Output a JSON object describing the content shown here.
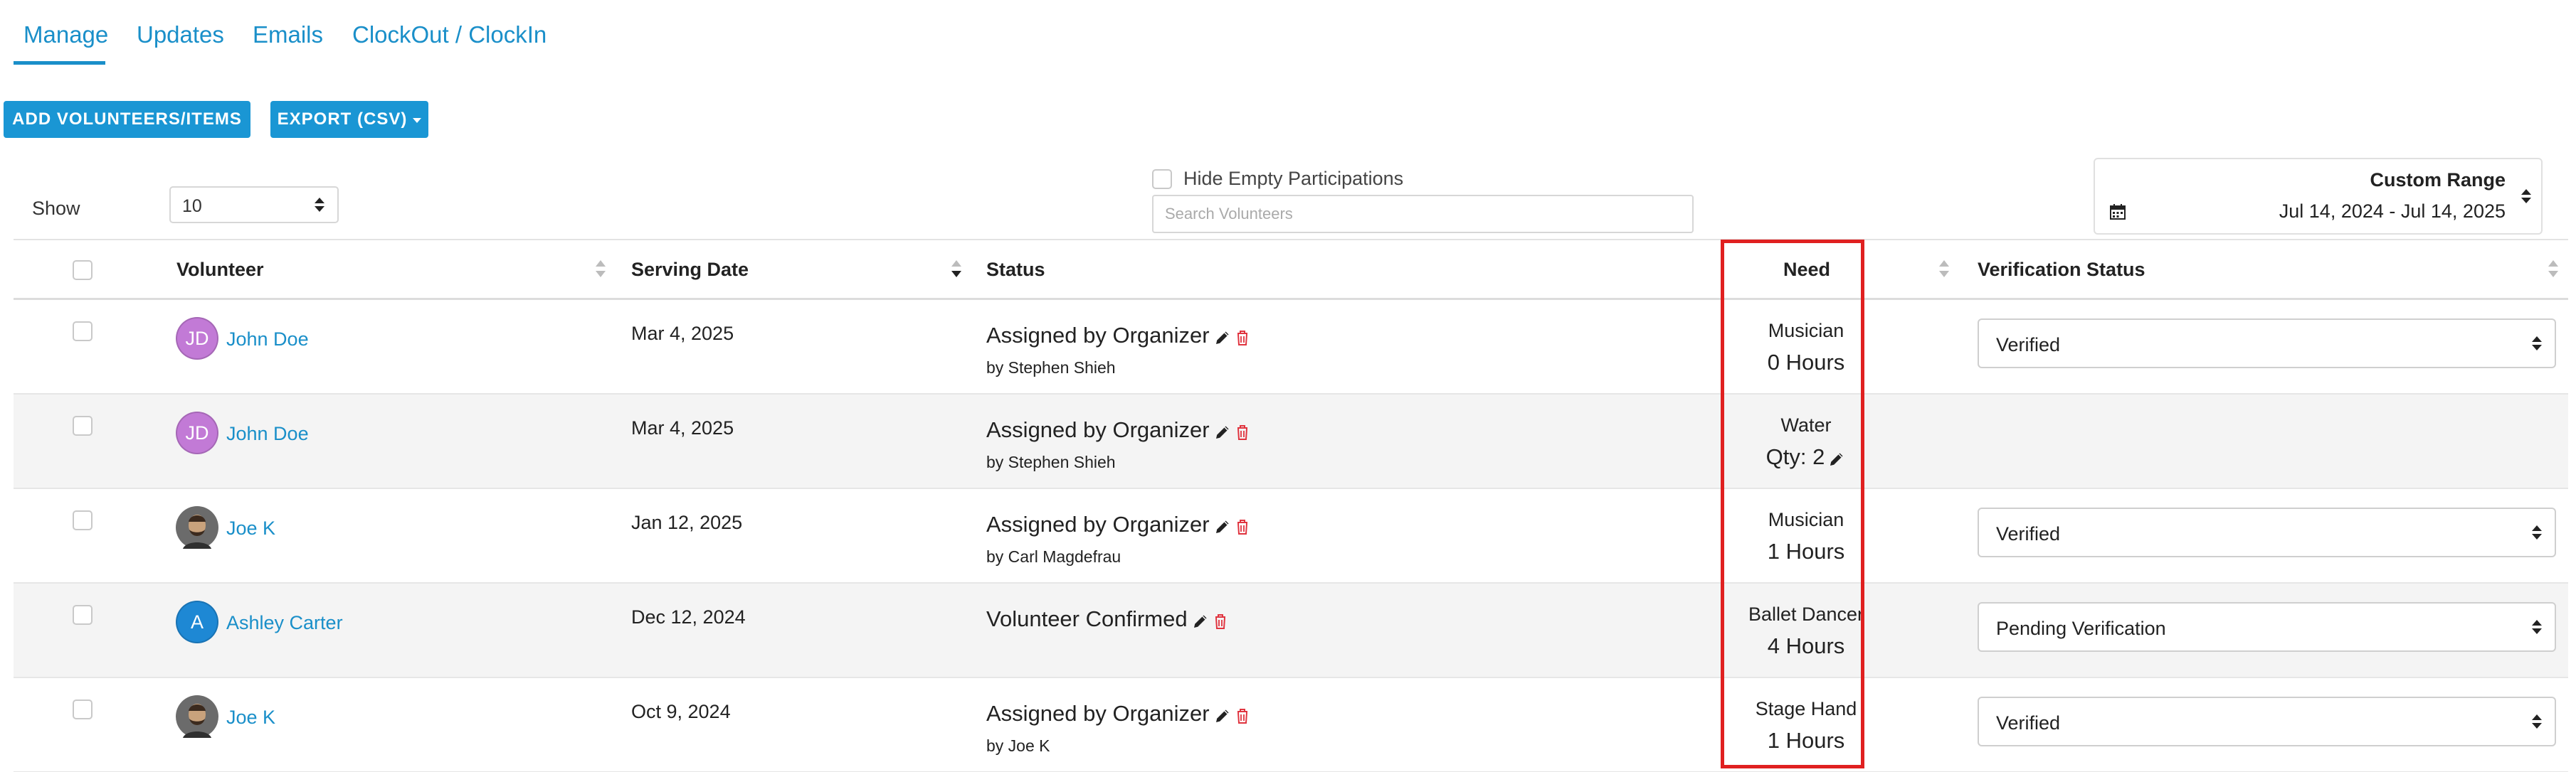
{
  "tabs": [
    {
      "label": "Manage"
    },
    {
      "label": "Updates"
    },
    {
      "label": "Emails"
    },
    {
      "label": "ClockOut / ClockIn"
    }
  ],
  "actions": {
    "add_label": "ADD VOLUNTEERS/ITEMS",
    "export_label": "EXPORT (CSV)"
  },
  "controls": {
    "show_label": "Show",
    "show_value": "10",
    "hide_empty_label": "Hide Empty Participations",
    "search_placeholder": "Search Volunteers",
    "range_title": "Custom Range",
    "range_value": "Jul 14, 2024 - Jul 14, 2025"
  },
  "columns": {
    "volunteer": "Volunteer",
    "serving_date": "Serving Date",
    "status": "Status",
    "need": "Need",
    "verification": "Verification Status"
  },
  "colors": {
    "accent": "#1a96d4",
    "link": "#1a8fc9",
    "highlight": "#e02020",
    "delete_icon": "#e0343f"
  },
  "rows": [
    {
      "avatar_initials": "JD",
      "avatar_color": "#c27ad6",
      "avatar_type": "initials",
      "volunteer": "John Doe",
      "date": "Mar 4, 2025",
      "status": "Assigned by Organizer",
      "status_by": "by Stephen Shieh",
      "need_name": "Musician",
      "need_detail": "0 Hours",
      "verification": "Verified"
    },
    {
      "avatar_initials": "JD",
      "avatar_color": "#c27ad6",
      "avatar_type": "initials",
      "volunteer": "John Doe",
      "date": "Mar 4, 2025",
      "status": "Assigned by Organizer",
      "status_by": "by Stephen Shieh",
      "need_name": "Water",
      "need_detail": "Qty: 2",
      "verification": ""
    },
    {
      "avatar_initials": "",
      "avatar_color": "#5a5a5a",
      "avatar_type": "photo",
      "volunteer": "Joe K",
      "date": "Jan 12, 2025",
      "status": "Assigned by Organizer",
      "status_by": "by Carl Magdefrau",
      "need_name": "Musician",
      "need_detail": "1 Hours",
      "verification": "Verified"
    },
    {
      "avatar_initials": "A",
      "avatar_color": "#1e88d4",
      "avatar_type": "initials",
      "volunteer": "Ashley Carter",
      "date": "Dec 12, 2024",
      "status": "Volunteer Confirmed",
      "status_by": "",
      "need_name": "Ballet Dancer",
      "need_detail": "4 Hours",
      "verification": "Pending Verification"
    },
    {
      "avatar_initials": "",
      "avatar_color": "#5a5a5a",
      "avatar_type": "photo",
      "volunteer": "Joe K",
      "date": "Oct 9, 2024",
      "status": "Assigned by Organizer",
      "status_by": "by Joe K",
      "need_name": "Stage Hand",
      "need_detail": "1 Hours",
      "verification": "Verified"
    }
  ]
}
